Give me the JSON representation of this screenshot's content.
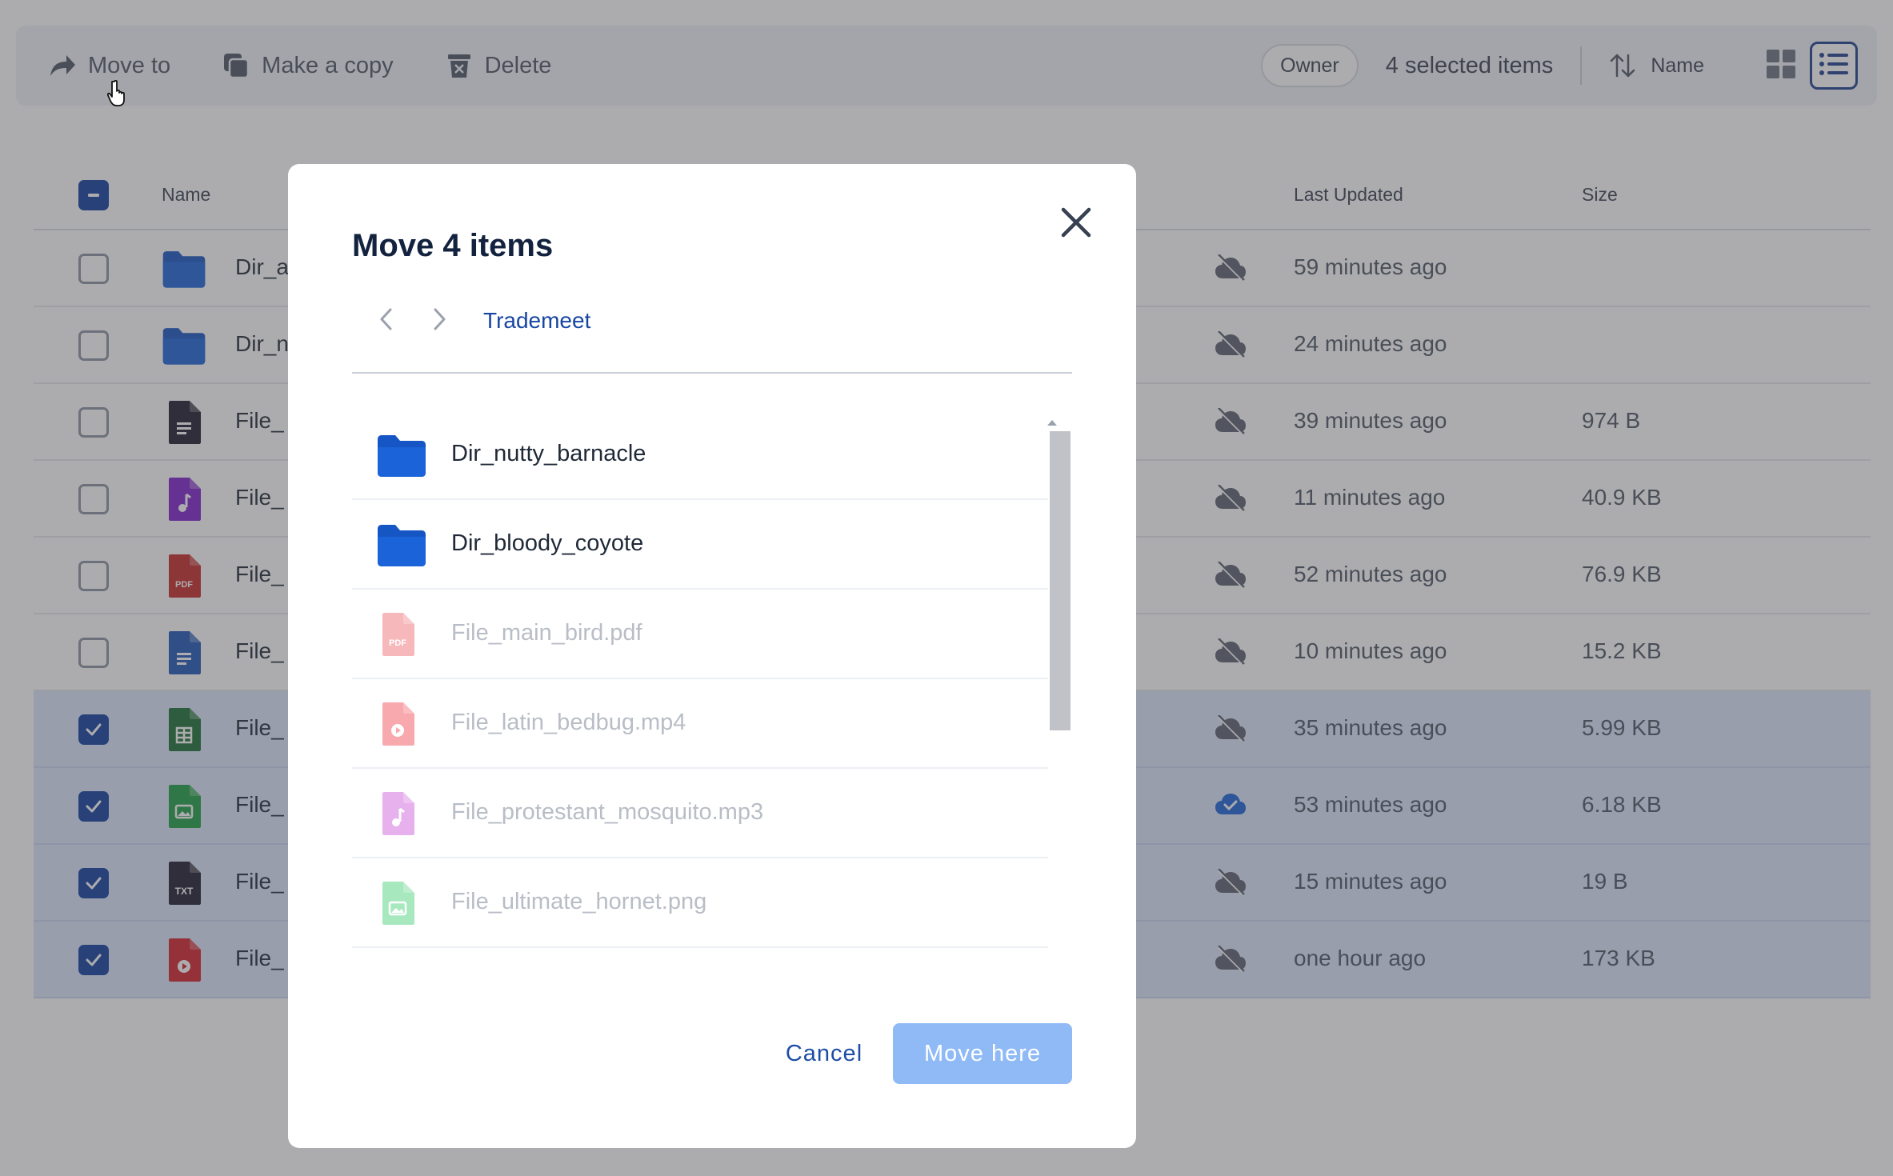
{
  "toolbar": {
    "move_to": "Move to",
    "make_copy": "Make a copy",
    "delete": "Delete",
    "owner": "Owner",
    "selected_count": "4 selected items",
    "sort_label": "Name"
  },
  "table": {
    "headers": {
      "name": "Name",
      "last_updated": "Last Updated",
      "size": "Size"
    },
    "rows": [
      {
        "name": "Dir_a",
        "type": "folder",
        "updated": "59 minutes ago",
        "size": "",
        "selected": false,
        "synced": false
      },
      {
        "name": "Dir_n",
        "type": "folder",
        "updated": "24 minutes ago",
        "size": "",
        "selected": false,
        "synced": false
      },
      {
        "name": "File_",
        "type": "doc-dark",
        "updated": "39 minutes ago",
        "size": "974 B",
        "selected": false,
        "synced": false
      },
      {
        "name": "File_",
        "type": "audio",
        "updated": "11 minutes ago",
        "size": "40.9 KB",
        "selected": false,
        "synced": false
      },
      {
        "name": "File_",
        "type": "pdf",
        "updated": "52 minutes ago",
        "size": "76.9 KB",
        "selected": false,
        "synced": false
      },
      {
        "name": "File_",
        "type": "doc",
        "updated": "10 minutes ago",
        "size": "15.2 KB",
        "selected": false,
        "synced": false
      },
      {
        "name": "File_",
        "type": "sheet",
        "updated": "35 minutes ago",
        "size": "5.99 KB",
        "selected": true,
        "synced": false
      },
      {
        "name": "File_",
        "type": "image",
        "updated": "53 minutes ago",
        "size": "6.18 KB",
        "selected": true,
        "synced": true
      },
      {
        "name": "File_",
        "type": "txt",
        "updated": "15 minutes ago",
        "size": "19 B",
        "selected": true,
        "synced": false
      },
      {
        "name": "File_",
        "type": "video",
        "updated": "one hour ago",
        "size": "173 KB",
        "selected": true,
        "synced": false
      }
    ]
  },
  "modal": {
    "title": "Move 4 items",
    "breadcrumb": "Trademeet",
    "items": [
      {
        "label": "Dir_nutty_barnacle",
        "type": "folder",
        "disabled": false
      },
      {
        "label": "Dir_bloody_coyote",
        "type": "folder",
        "disabled": false
      },
      {
        "label": "File_main_bird.pdf",
        "type": "pdf",
        "disabled": true
      },
      {
        "label": "File_latin_bedbug.mp4",
        "type": "video",
        "disabled": true
      },
      {
        "label": "File_protestant_mosquito.mp3",
        "type": "audio",
        "disabled": true
      },
      {
        "label": "File_ultimate_hornet.png",
        "type": "image",
        "disabled": true
      }
    ],
    "cancel": "Cancel",
    "move_here": "Move here"
  },
  "icon_badges": {
    "pdf": "PDF",
    "txt": "TXT"
  },
  "colors": {
    "primary": "#0f3c9e",
    "folder": "#1a63d8",
    "move_button_disabled": "#8fbaf6",
    "selected_row": "#dbe6fb"
  }
}
